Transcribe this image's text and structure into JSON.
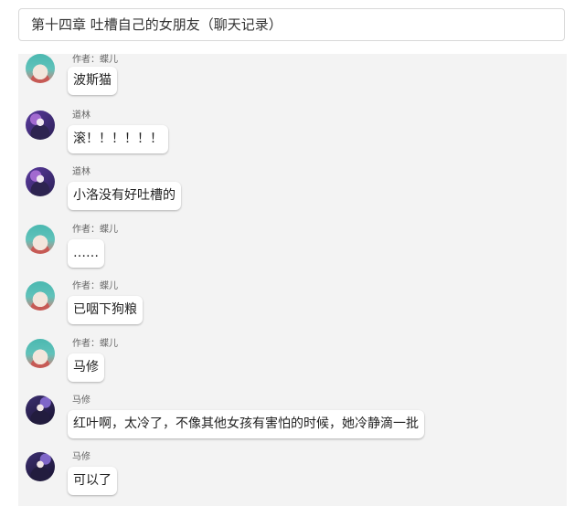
{
  "chapter_title": "第十四章 吐槽自己的女朋友（聊天记录）",
  "messages": [
    {
      "sender": "作者：蝶儿",
      "text": "波斯猫",
      "avatar": "cat-avatar"
    },
    {
      "sender": "道林",
      "text": "滚！！！！！！",
      "avatar": "daolin-avatar"
    },
    {
      "sender": "道林",
      "text": "小洛没有好吐槽的",
      "avatar": "daolin-avatar"
    },
    {
      "sender": "作者：蝶儿",
      "text": "……",
      "avatar": "cat-avatar"
    },
    {
      "sender": "作者：蝶儿",
      "text": "已咽下狗粮",
      "avatar": "cat-avatar"
    },
    {
      "sender": "作者：蝶儿",
      "text": "马修",
      "avatar": "cat-avatar"
    },
    {
      "sender": "马修",
      "text": "红叶啊，太冷了，不像其他女孩有害怕的时候，她冷静滴一批",
      "avatar": "maxiu-avatar"
    },
    {
      "sender": "马修",
      "text": "可以了",
      "avatar": "maxiu-avatar"
    }
  ],
  "colors": {
    "panel_bg": "#f3f3f3",
    "bubble_bg": "#ffffff",
    "text": "#222222",
    "name_text": "#666666"
  }
}
